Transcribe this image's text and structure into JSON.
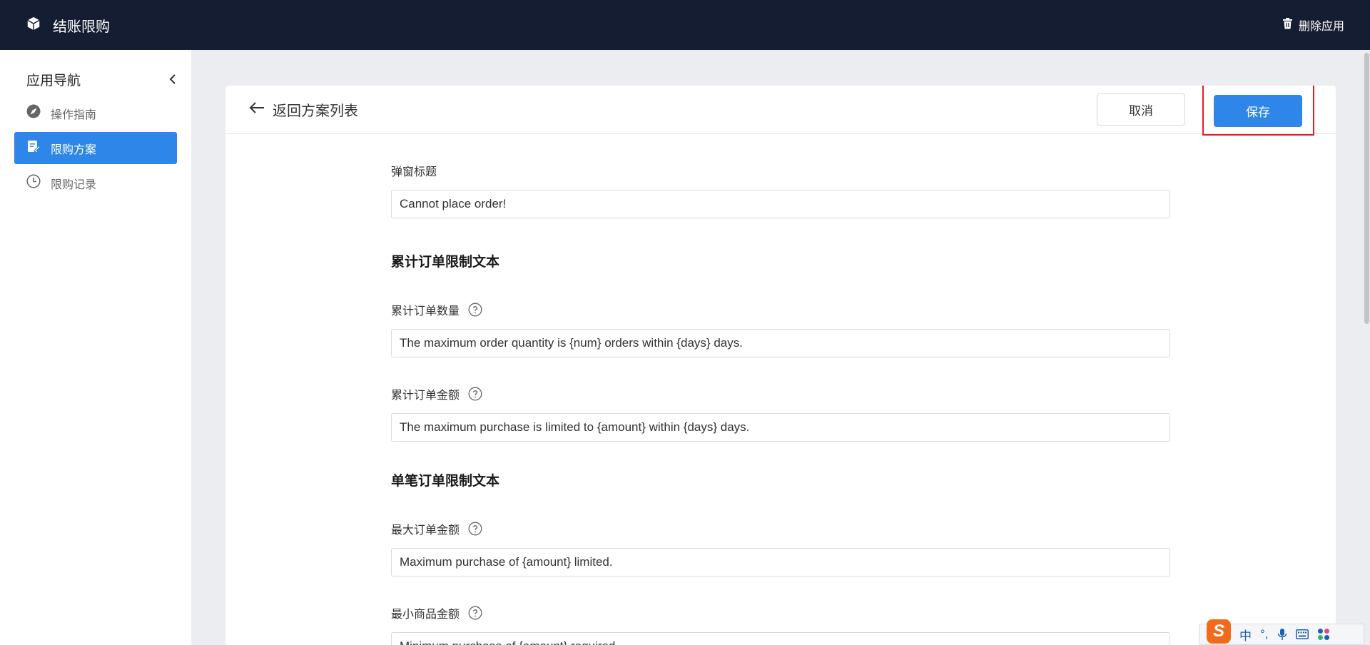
{
  "app": {
    "title": "结账限购",
    "delete_label": "删除应用"
  },
  "sidebar": {
    "title": "应用导航",
    "items": [
      {
        "label": "操作指南",
        "icon": "compass-icon"
      },
      {
        "label": "限购方案",
        "icon": "edit-document-icon",
        "active": true
      },
      {
        "label": "限购记录",
        "icon": "clock-icon"
      }
    ]
  },
  "header": {
    "back_label": "返回方案列表",
    "cancel_label": "取消",
    "save_label": "保存"
  },
  "form": {
    "popup_title": {
      "label": "弹窗标题",
      "value": "Cannot place order!"
    },
    "section_cumulative": "累计订单限制文本",
    "cumulative_quantity": {
      "label": "累计订单数量",
      "value": "The maximum order quantity is {num} orders within {days} days."
    },
    "cumulative_amount": {
      "label": "累计订单金额",
      "value": "The maximum purchase is limited to {amount} within {days} days."
    },
    "section_single": "单笔订单限制文本",
    "max_order_amount": {
      "label": "最大订单金额",
      "value": "Maximum purchase of {amount} limited."
    },
    "min_product_amount": {
      "label": "最小商品金额",
      "value": "Minimum purchase of {amount} required."
    }
  },
  "ime": {
    "logo": "S",
    "mode": "中",
    "punct": "°,"
  },
  "colors": {
    "topbar": "#151d32",
    "accent": "#2e87e8",
    "highlight": "#e02020"
  }
}
